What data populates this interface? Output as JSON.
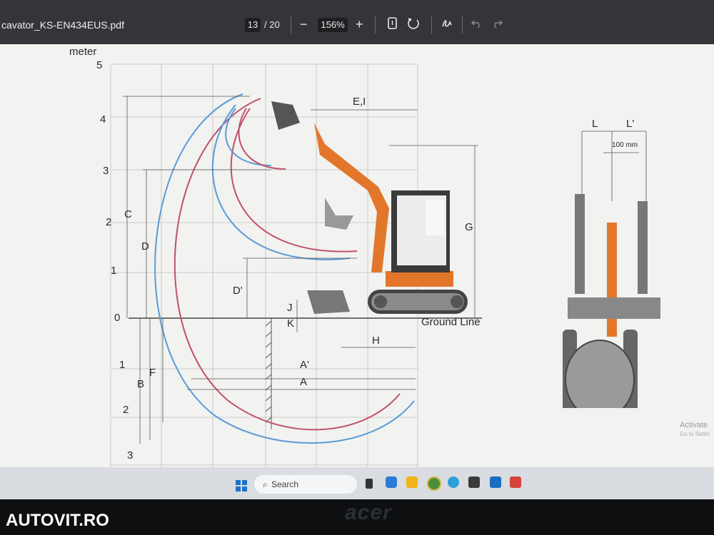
{
  "toolbar": {
    "file_name": "cavator_KS-EN434EUS.pdf",
    "current_page": "13",
    "total_pages": "/ 20",
    "zoom_out_label": "−",
    "zoom_value": "156%",
    "zoom_in_label": "+"
  },
  "diagram": {
    "unit_label": "meter",
    "y_ticks_top": [
      "5",
      "4",
      "3",
      "2",
      "1",
      "0"
    ],
    "y_ticks_bottom": [
      "1",
      "2",
      "3"
    ],
    "dimension_labels": {
      "c": "C",
      "d": "D",
      "d_prime": "D'",
      "f": "F",
      "b": "B",
      "a": "A",
      "a_prime": "A'",
      "h": "H",
      "j": "J",
      "k": "K",
      "ei": "E,I",
      "g": "G",
      "l": "L",
      "l_prime": "L'"
    },
    "ground_line": "Ground Line",
    "blade_offset": "100 mm"
  },
  "taskbar": {
    "search_placeholder": "Search"
  },
  "overlay": {
    "activate_title": "Activate",
    "activate_sub": "Go to Settin"
  },
  "laptop_brand": "acer",
  "watermark": "AUTOVIT.RO"
}
